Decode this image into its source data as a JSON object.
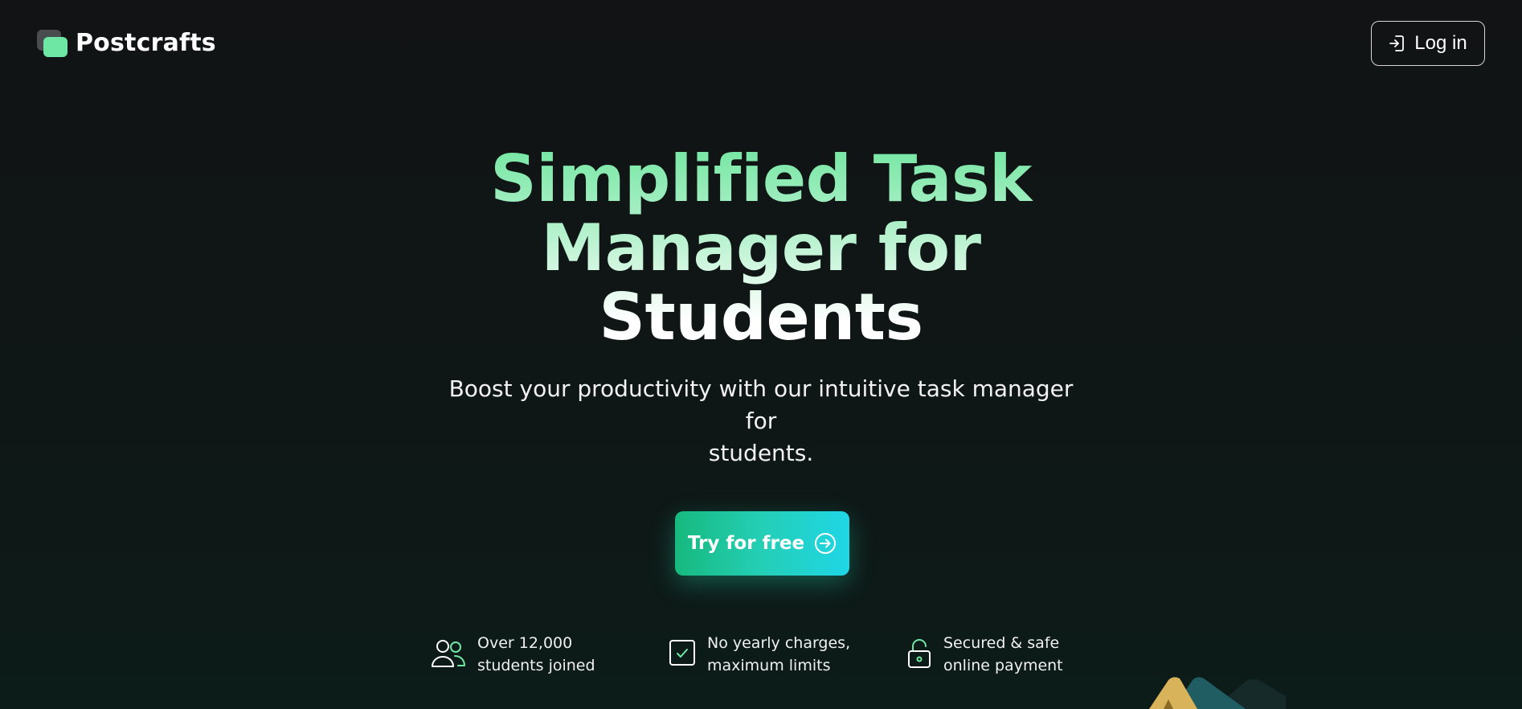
{
  "brand": {
    "name": "Postcrafts",
    "logo_icon": "postcrafts-logo-icon",
    "logo_colors": [
      "#4a4d4f",
      "#6ee7a5"
    ]
  },
  "header": {
    "login_label": "Log in",
    "login_icon": "login-icon"
  },
  "hero": {
    "title_lines": [
      "Simplified Task",
      "Manager for",
      "Students"
    ],
    "subtitle_lines": [
      "Boost your productivity with our intuitive task manager for",
      "students."
    ],
    "title_gradient": [
      "#74e6a2",
      "#ffffff"
    ]
  },
  "cta": {
    "label": "Try for free",
    "icon": "arrow-right-circle-icon",
    "gradient": [
      "#17b97e",
      "#1fd6e6"
    ]
  },
  "features": [
    {
      "icon": "users-icon",
      "lines": [
        "Over 12,000",
        "students joined"
      ]
    },
    {
      "icon": "checkbox-icon",
      "lines": [
        "No yearly charges,",
        "maximum limits"
      ]
    },
    {
      "icon": "lock-icon",
      "lines": [
        "Secured & safe",
        "online payment"
      ]
    }
  ],
  "colors": {
    "background": "#111314",
    "accent": "#6ee7a5",
    "text": "#ffffff"
  }
}
